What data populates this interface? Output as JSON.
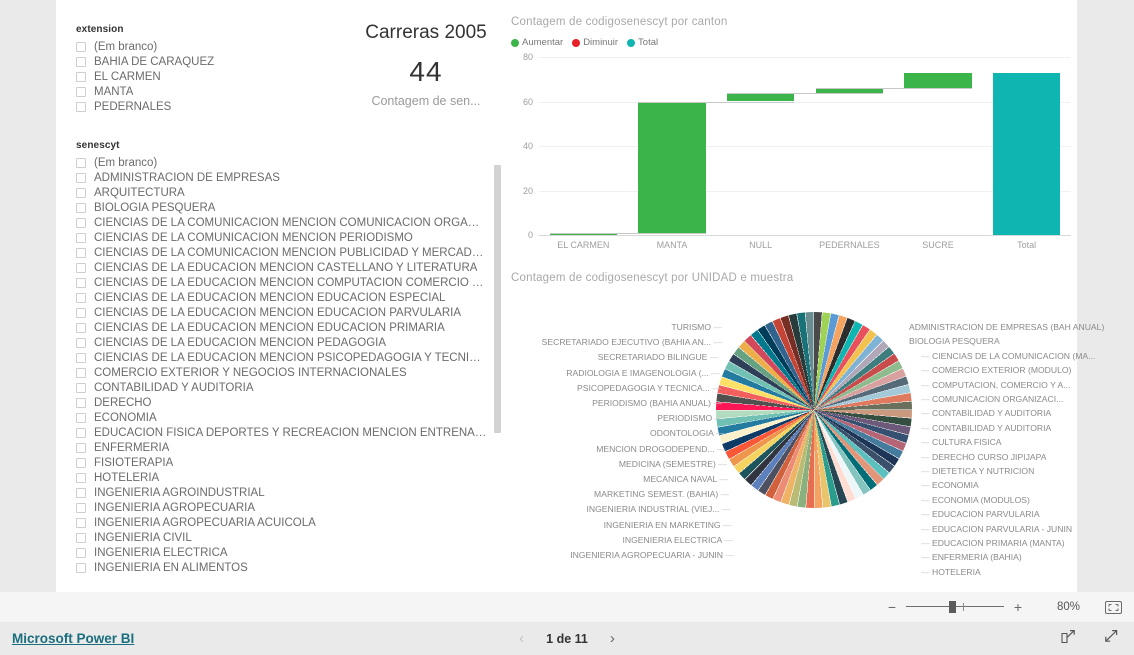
{
  "extension_slicer": {
    "title": "extension",
    "items": [
      {
        "label": "(Em branco)",
        "checked": false
      },
      {
        "label": "BAHIA DE CARAQUEZ",
        "checked": false
      },
      {
        "label": "EL CARMEN",
        "checked": false
      },
      {
        "label": "MANTA",
        "checked": false
      },
      {
        "label": "PEDERNALES",
        "checked": false
      }
    ]
  },
  "senescyt_slicer": {
    "title": "senescyt",
    "items": [
      {
        "label": "(Em branco)"
      },
      {
        "label": "ADMINISTRACION DE EMPRESAS"
      },
      {
        "label": "ARQUITECTURA"
      },
      {
        "label": "BIOLOGIA PESQUERA"
      },
      {
        "label": "CIENCIAS DE LA COMUNICACION MENCION COMUNICACION ORGANIZACIO..."
      },
      {
        "label": "CIENCIAS DE LA COMUNICACION MENCION PERIODISMO"
      },
      {
        "label": "CIENCIAS DE LA COMUNICACION MENCION PUBLICIDAD Y MERCADOTECNIA"
      },
      {
        "label": "CIENCIAS DE LA EDUCACION MENCION CASTELLANO Y LITERATURA"
      },
      {
        "label": "CIENCIAS DE LA EDUCACION MENCION COMPUTACION COMERCIO Y ADMIN..."
      },
      {
        "label": "CIENCIAS DE LA EDUCACION MENCION EDUCACION ESPECIAL"
      },
      {
        "label": "CIENCIAS DE LA EDUCACION MENCION EDUCACION PARVULARIA"
      },
      {
        "label": "CIENCIAS DE LA EDUCACION MENCION EDUCACION PRIMARIA"
      },
      {
        "label": "CIENCIAS DE LA EDUCACION MENCION PEDAGOGIA"
      },
      {
        "label": "CIENCIAS DE LA EDUCACION MENCION PSICOPEDAGOGIA Y TECNICAS DE LA..."
      },
      {
        "label": "COMERCIO EXTERIOR Y NEGOCIOS INTERNACIONALES"
      },
      {
        "label": "CONTABILIDAD Y AUDITORIA"
      },
      {
        "label": "DERECHO"
      },
      {
        "label": "ECONOMIA"
      },
      {
        "label": "EDUCACION FISICA DEPORTES Y RECREACION MENCION ENTRENAMIENTO D..."
      },
      {
        "label": "ENFERMERIA"
      },
      {
        "label": "FISIOTERAPIA"
      },
      {
        "label": "HOTELERIA"
      },
      {
        "label": "INGENIERIA AGROINDUSTRIAL"
      },
      {
        "label": "INGENIERIA AGROPECUARIA"
      },
      {
        "label": "INGENIERIA AGROPECUARIA ACUICOLA"
      },
      {
        "label": "INGENIERIA CIVIL"
      },
      {
        "label": "INGENIERIA ELECTRICA"
      },
      {
        "label": "INGENIERIA EN ALIMENTOS"
      }
    ]
  },
  "kpi_card": {
    "title": "Carreras 2005",
    "value": "44",
    "subtitle": "Contagem de  sen..."
  },
  "chart_data": [
    {
      "type": "bar",
      "chart_style": "waterfall",
      "title": "Contagem de  codigosenescyt por  canton",
      "xlabel": "",
      "ylabel": "",
      "ylim": [
        0,
        80
      ],
      "yticks": [
        0,
        20,
        40,
        60,
        80
      ],
      "grid": true,
      "legend_position": "top-left",
      "legend": [
        {
          "name": "Aumentar",
          "color": "#3bb44a"
        },
        {
          "name": "Diminuir",
          "color": "#e8202a"
        },
        {
          "name": "Total",
          "color": "#0fb5b0"
        }
      ],
      "categories": [
        "EL CARMEN",
        "MANTA",
        "NULL",
        "PEDERNALES",
        "SUCRE",
        "Total"
      ],
      "deltas": [
        1,
        59,
        4,
        2,
        7,
        null
      ],
      "cumulative_start": [
        0,
        1,
        60,
        64,
        66,
        0
      ],
      "cumulative_end": [
        1,
        60,
        64,
        66,
        73,
        73
      ],
      "values": [
        1,
        59,
        4,
        2,
        7,
        73
      ],
      "bar_kinds": [
        "increase",
        "increase",
        "increase",
        "increase",
        "increase",
        "total"
      ]
    },
    {
      "type": "pie",
      "title": "Contagem de  codigosenescyt por  UNIDAD e  muestra",
      "labels_left": [
        "TURISMO",
        "SECRETARIADO EJECUTIVO (BAHIA AN...",
        "SECRETARIADO BILINGUE",
        "RADIOLOGIA E IMAGENOLOGIA (...",
        "PSICOPEDAGOGIA Y TECNICA...",
        "PERIODISMO (BAHIA ANUAL)",
        "PERIODISMO",
        "ODONTOLOGIA",
        "MENCION DROGODEPEND...",
        "MEDICINA (SEMESTRE)",
        "MECANICA NAVAL",
        "MARKETING SEMEST. (BAHIA)",
        "INGENIERIA INDUSTRIAL (VIEJ...",
        "INGENIERIA EN MARKETING",
        "INGENIERIA ELECTRICA",
        "INGENIERIA AGROPECUARIA - JUNIN"
      ],
      "labels_right": [
        "ADMINISTRACION DE EMPRESAS (BAH ANUAL)",
        "BIOLOGIA PESQUERA",
        "CIENCIAS DE LA COMUNICACION (MA...",
        "COMERCIO EXTERIOR  (MODULO)",
        "COMPUTACION, COMERCIO Y A...",
        "COMUNICACION ORGANIZACI...",
        "CONTABILIDAD Y AUDITORIA",
        "CONTABILIDAD Y AUDITORIA",
        "CULTURA FISICA",
        "DERECHO CURSO JIPIJAPA",
        "DIETETICA Y NUTRICION",
        "ECONOMIA",
        "ECONOMIA (MODULOS)",
        "EDUCACION PARVULARIA",
        "EDUCACION PARVULARIA - JUNIN",
        "EDUCACION PRIMARIA (MANTA)",
        "ENFERMERIA (BAHIA)",
        "HOTELERIA"
      ],
      "slice_count": 72,
      "note": "All slices are near-equal thin wedges"
    }
  ],
  "statusbar": {
    "zoom_minus": "−",
    "zoom_plus": "+",
    "zoom_percent": "80%",
    "fit_icon": "fit-to-page-icon"
  },
  "footer": {
    "brand": "Microsoft Power BI",
    "page_label": "1 de 11",
    "prev_icon": "chevron-left-icon",
    "next_icon": "chevron-right-icon",
    "share_icon": "share-icon",
    "fullscreen_icon": "fullscreen-icon"
  },
  "colors": {
    "increase": "#3bb44a",
    "decrease": "#e8202a",
    "total": "#0fb5b0",
    "brand_link": "#1a6e7e",
    "canvas": "#ffffff",
    "shell": "#eaeaea"
  }
}
